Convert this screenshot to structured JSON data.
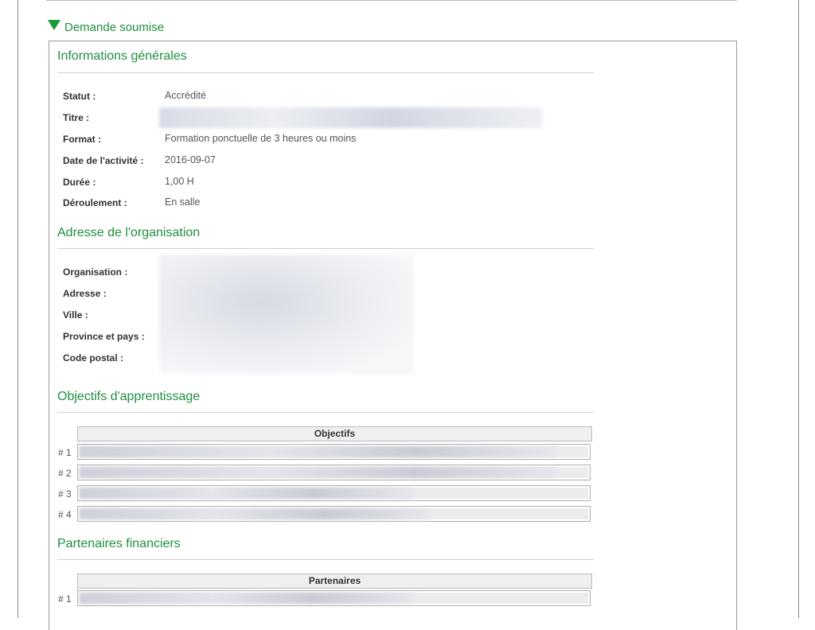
{
  "section": {
    "title": "Demande soumise"
  },
  "general": {
    "title": "Informations générales",
    "fields": [
      {
        "label": "Statut :",
        "value": "Accrédité"
      },
      {
        "label": "Titre :",
        "value": ""
      },
      {
        "label": "Format :",
        "value": "Formation ponctuelle de 3 heures ou moins"
      },
      {
        "label": "Date de l'activité :",
        "value": "2016-09-07"
      },
      {
        "label": "Durée :",
        "value": "1,00 H"
      },
      {
        "label": "Déroulement :",
        "value": "En salle"
      }
    ]
  },
  "address": {
    "title": "Adresse de l'organisation",
    "fields": [
      {
        "label": "Organisation :"
      },
      {
        "label": "Adresse :"
      },
      {
        "label": "Ville :"
      },
      {
        "label": "Province et pays :"
      },
      {
        "label": "Code postal :"
      }
    ]
  },
  "objectives": {
    "title": "Objectifs d'apprentissage",
    "header": "Objectifs",
    "rows": [
      "# 1",
      "# 2",
      "# 3",
      "# 4"
    ]
  },
  "partners": {
    "title": "Partenaires financiers",
    "header": "Partenaires",
    "rows": [
      "# 1"
    ]
  },
  "colors": {
    "accent": "#1f8f3d",
    "triangle": "#1a9a3c"
  }
}
